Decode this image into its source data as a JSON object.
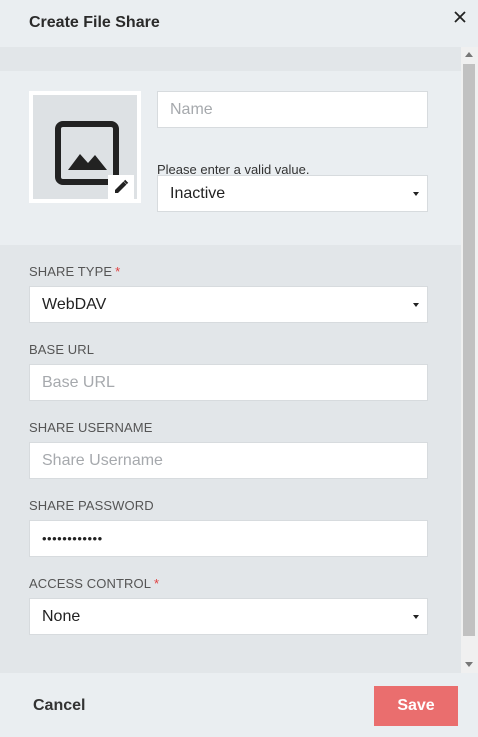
{
  "dialog": {
    "title": "Create File Share",
    "close_icon": "close-icon"
  },
  "profile": {
    "image_icon": "image-placeholder-icon",
    "edit_icon": "pencil-icon",
    "name_placeholder": "Name",
    "name_value": "",
    "validation_message": "Please enter a valid value.",
    "status_value": "Inactive"
  },
  "form": {
    "share_type": {
      "label": "SHARE TYPE",
      "required": "*",
      "value": "WebDAV"
    },
    "base_url": {
      "label": "BASE URL",
      "placeholder": "Base URL",
      "value": ""
    },
    "share_username": {
      "label": "SHARE USERNAME",
      "placeholder": "Share Username",
      "value": ""
    },
    "share_password": {
      "label": "SHARE PASSWORD",
      "value": "••••••••••••"
    },
    "access_control": {
      "label": "ACCESS CONTROL",
      "required": "*",
      "value": "None"
    }
  },
  "footer": {
    "cancel_label": "Cancel",
    "save_label": "Save"
  },
  "colors": {
    "accent": "#ea6e6e",
    "required": "#e04040",
    "header_bg": "#eaeef1",
    "section_bg": "#e2e6e9"
  }
}
